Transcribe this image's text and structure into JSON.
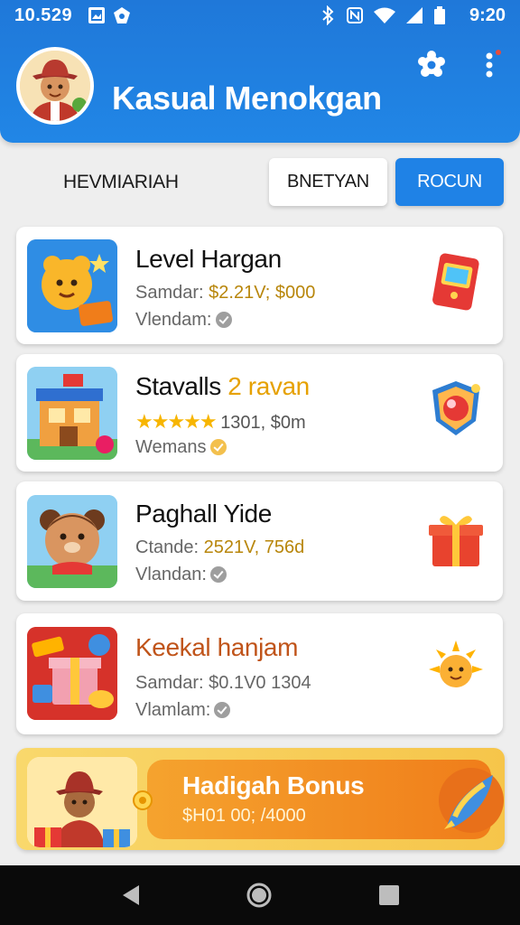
{
  "status_bar": {
    "time_left": "10.529",
    "time_right": "9:20"
  },
  "header": {
    "title": "Kasual Menokgan"
  },
  "tabs": {
    "static_label": "HEVMIARIAH",
    "tab1": "BNETYAN",
    "tab2": "ROCUN"
  },
  "cards": [
    {
      "title": "Level Hargan",
      "line1_label": "Samdar:",
      "line1_value": "$2.21V; $000",
      "line2": "Vlendam:",
      "title_color": "#111111"
    },
    {
      "title_main": "Stavalls",
      "title_accent": "2 ravan",
      "rating_text": "1301, $0m",
      "line2": "Wemans",
      "stars": 5
    },
    {
      "title": "Paghall Yide",
      "line1_label": "Ctande:",
      "line1_value": "2521V, 756d",
      "line2": "Vlandan:"
    },
    {
      "title": "Keekal hanjam",
      "line1_label": "Samdar:",
      "line1_value": "$0.1V0 1304",
      "line2": "Vlamlam:"
    }
  ],
  "bonus": {
    "title": "Hadigah Bonus",
    "subtitle": "$H01 00; /4000"
  },
  "colors": {
    "primary": "#1f82e6",
    "accent": "#f07d1a",
    "price": "#b8860b",
    "highlight_title": "#c0541a"
  }
}
